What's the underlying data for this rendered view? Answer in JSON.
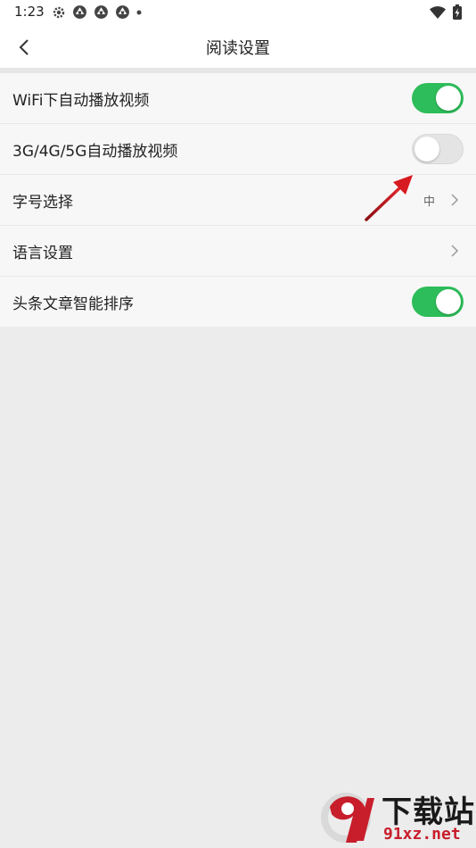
{
  "status_bar": {
    "time": "1:23"
  },
  "header": {
    "title": "阅读设置",
    "back_icon": "chevron-left-icon"
  },
  "settings": [
    {
      "label": "WiFi下自动播放视频",
      "type": "toggle",
      "on": true
    },
    {
      "label": "3G/4G/5G自动播放视频",
      "type": "toggle",
      "on": false
    },
    {
      "label": "字号选择",
      "type": "link",
      "value": "中"
    },
    {
      "label": "语言设置",
      "type": "link",
      "value": ""
    },
    {
      "label": "头条文章智能排序",
      "type": "toggle",
      "on": true
    }
  ],
  "colors": {
    "toggle_on": "#2dbd5a",
    "toggle_off": "#e4e4e4",
    "annotation_arrow": "#d71920",
    "watermark_red": "#c81e2b"
  },
  "watermark": {
    "title": "下载站",
    "url": "91xz.net"
  }
}
